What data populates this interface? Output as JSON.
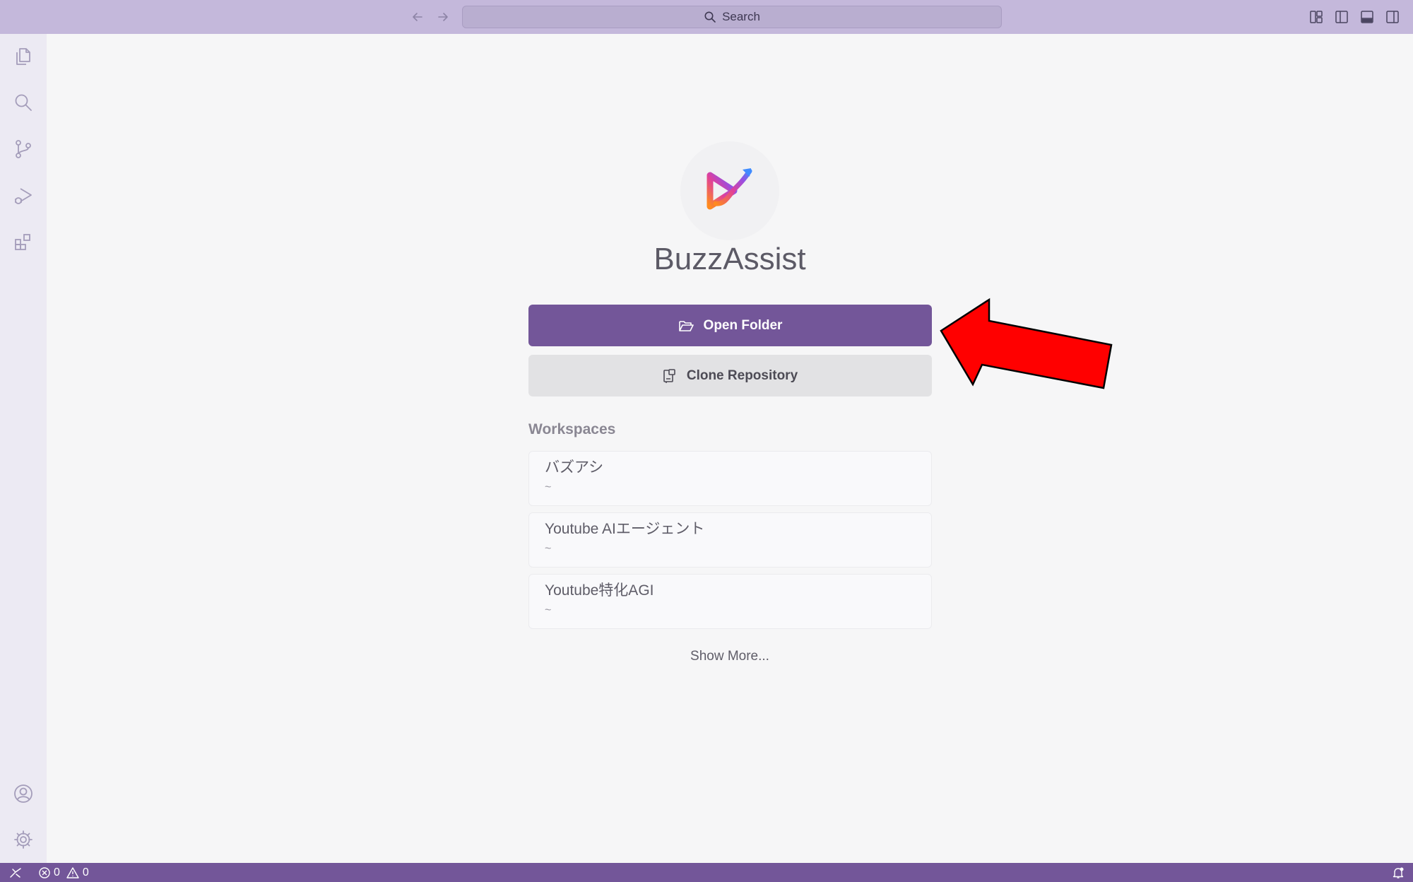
{
  "titlebar": {
    "search_label": "Search",
    "icons": [
      "arrow-left-icon",
      "arrow-right-icon",
      "search-icon",
      "customize-layout-icon",
      "toggle-primary-sidebar-icon",
      "toggle-panel-icon",
      "toggle-secondary-sidebar-icon"
    ]
  },
  "activitybar": {
    "items": [
      "explorer-icon",
      "search-icon",
      "source-control-icon",
      "run-debug-icon",
      "extensions-icon"
    ],
    "bottom": [
      "account-icon",
      "gear-icon"
    ]
  },
  "welcome": {
    "app_name": "BuzzAssist",
    "open_folder_label": "Open Folder",
    "clone_repository_label": "Clone Repository",
    "workspaces_heading": "Workspaces",
    "workspaces": [
      {
        "name": "バズアシ",
        "path": "~"
      },
      {
        "name": "Youtube AIエージェント",
        "path": "~"
      },
      {
        "name": "Youtube特化AGI",
        "path": "~"
      }
    ],
    "show_more_label": "Show More..."
  },
  "statusbar": {
    "errors": "0",
    "warnings": "0"
  },
  "colors": {
    "accent": "#735699",
    "titlebar": "#c4b8db",
    "annotation_arrow": "#ff0000"
  }
}
